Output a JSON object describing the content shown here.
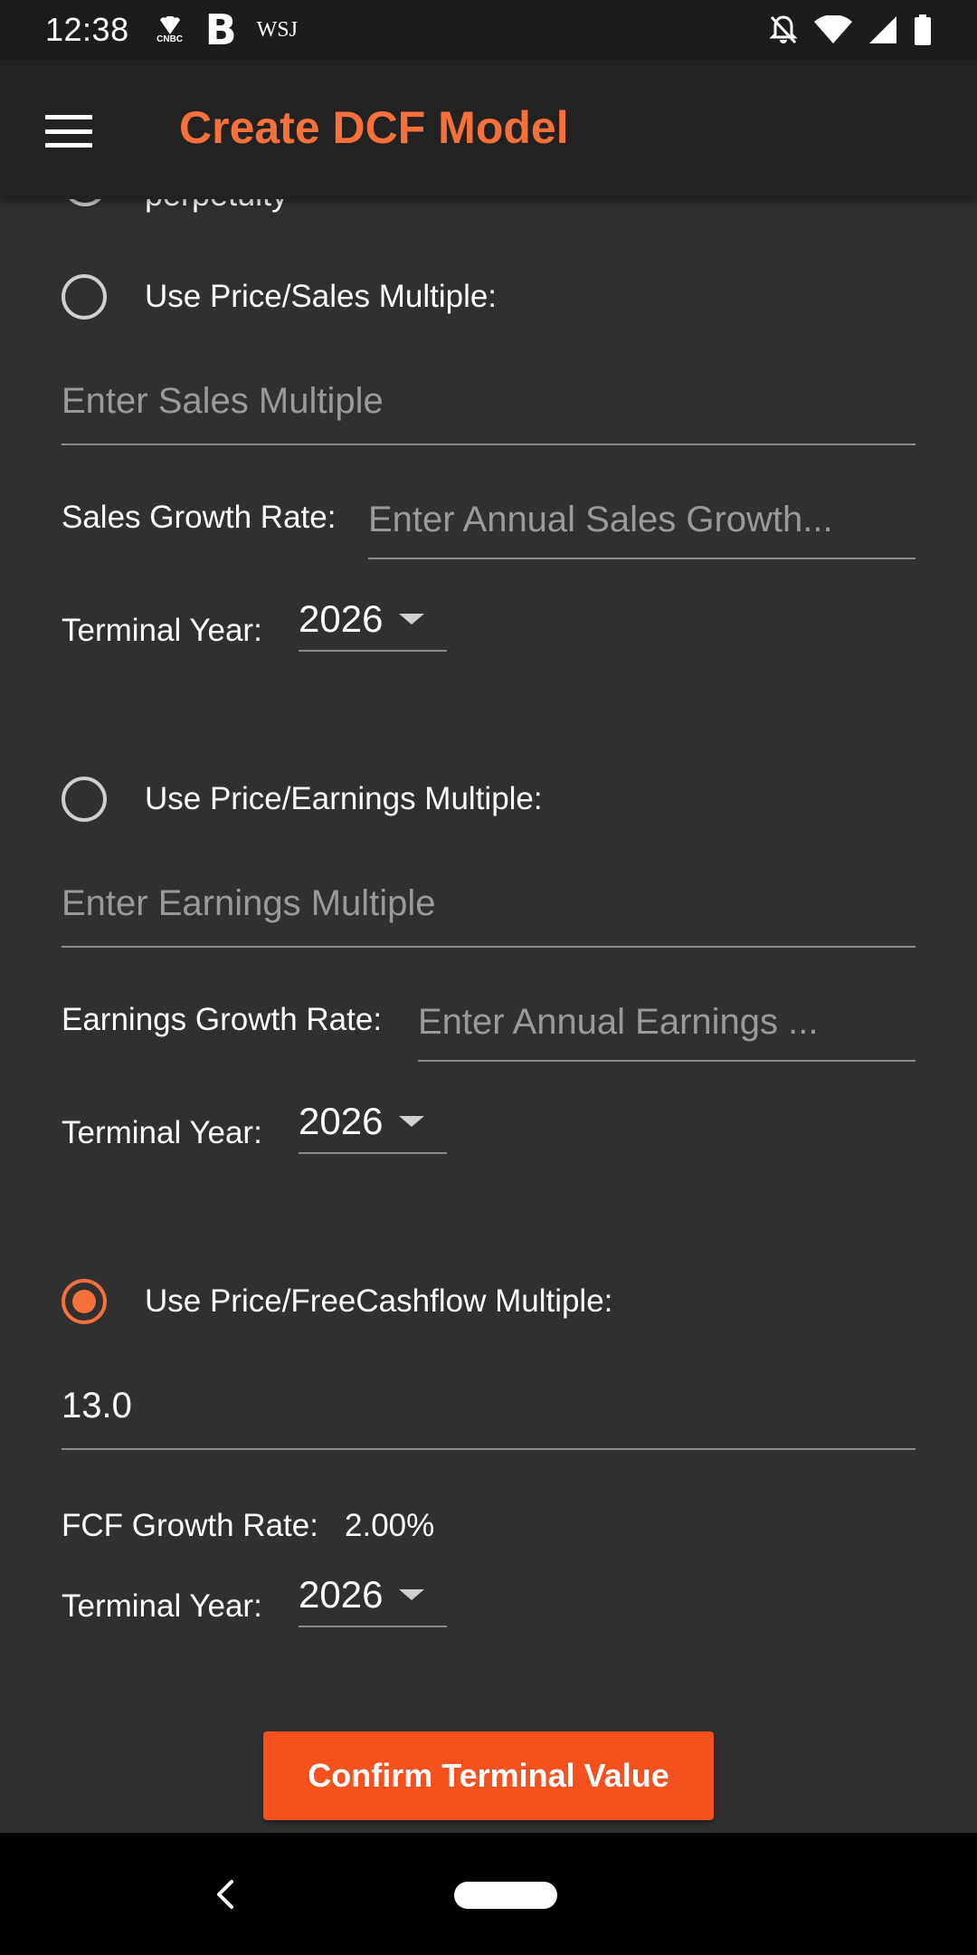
{
  "status_bar": {
    "time": "12:38",
    "apps": {
      "cnbc": "CNBC",
      "b": "B",
      "wsj": "WSJ"
    },
    "icons": [
      "notifications-off-icon",
      "wifi-icon",
      "cell-signal-icon",
      "battery-icon"
    ]
  },
  "app_bar": {
    "title": "Create DCF Model",
    "menu_icon": "hamburger-menu-icon",
    "title_color": "#f5703a"
  },
  "partial_option": {
    "label": "perpetuity"
  },
  "sales_section": {
    "radio_label": "Use Price/Sales Multiple:",
    "selected": false,
    "multiple_placeholder": "Enter Sales Multiple",
    "growth_label": "Sales Growth Rate:",
    "growth_placeholder": "Enter Annual Sales Growth...",
    "terminal_year_label": "Terminal Year:",
    "terminal_year": "2026"
  },
  "earnings_section": {
    "radio_label": "Use Price/Earnings Multiple:",
    "selected": false,
    "multiple_placeholder": "Enter Earnings Multiple",
    "growth_label": "Earnings Growth Rate:",
    "growth_placeholder": "Enter Annual Earnings ...",
    "terminal_year_label": "Terminal Year:",
    "terminal_year": "2026"
  },
  "fcf_section": {
    "radio_label": "Use Price/FreeCashflow Multiple:",
    "selected": true,
    "multiple_value": "13.0",
    "growth_label": "FCF Growth Rate:",
    "growth_value": "2.00%",
    "terminal_year_label": "Terminal Year:",
    "terminal_year": "2026"
  },
  "confirm_button": {
    "label": "Confirm Terminal Value",
    "color": "#f4511e"
  },
  "colors": {
    "background": "#303030",
    "accent": "#f5703a"
  }
}
